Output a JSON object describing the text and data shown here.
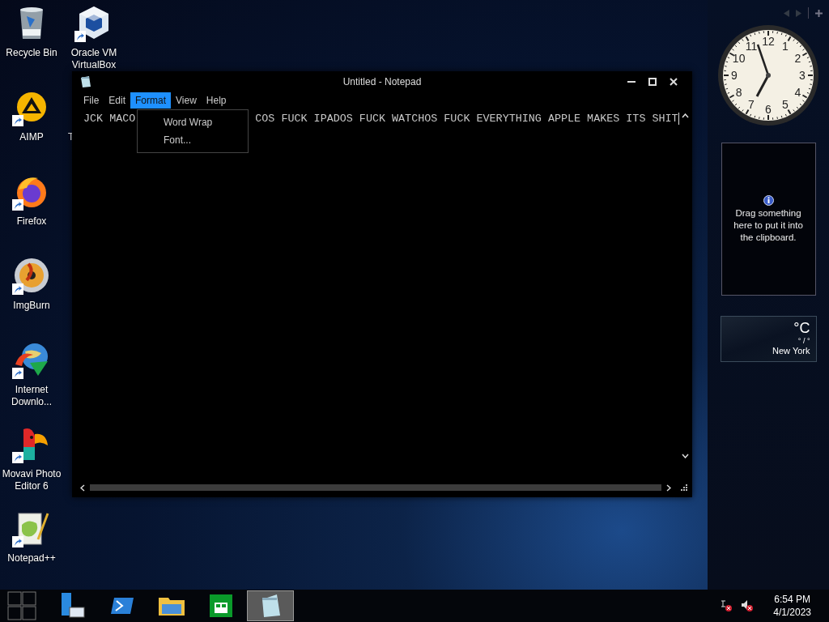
{
  "desktop_icons": [
    {
      "label": "Recycle Bin",
      "kind": "recycle",
      "shortcut": false
    },
    {
      "label": "AIMP",
      "kind": "aimp",
      "shortcut": true
    },
    {
      "label": "Firefox",
      "kind": "firefox",
      "shortcut": true
    },
    {
      "label": "ImgBurn",
      "kind": "disc",
      "shortcut": true
    },
    {
      "label": "Internet Downlo...",
      "kind": "globe",
      "shortcut": true
    },
    {
      "label": "Movavi Photo Editor 6",
      "kind": "parrot",
      "shortcut": true
    },
    {
      "label": "Notepad++",
      "kind": "notepadpp",
      "shortcut": true
    },
    {
      "label": "Oracle VM VirtualBox",
      "kind": "cube",
      "shortcut": true
    }
  ],
  "hidden_icon_label": "T",
  "notepad": {
    "title": "Untitled - Notepad",
    "menu": [
      {
        "label": "File",
        "selected": false
      },
      {
        "label": "Edit",
        "selected": false
      },
      {
        "label": "Format",
        "selected": true
      },
      {
        "label": "View",
        "selected": false
      },
      {
        "label": "Help",
        "selected": false
      }
    ],
    "dropdown": [
      {
        "label": "Word Wrap"
      },
      {
        "label": "Font..."
      }
    ],
    "text_segments": [
      "JCK MACO",
      "COS FUCK IPADOS FUCK WATCHOS FUCK EVERYTHING APPLE MAKES ITS SHIT"
    ]
  },
  "gadgets": {
    "clock": {
      "numerals": [
        "11",
        "12",
        "1",
        "10",
        "2",
        "9",
        "3",
        "8",
        "4",
        "7",
        "5",
        "6"
      ]
    },
    "clipboard": {
      "message": "Drag something here to put it into the clipboard."
    },
    "weather": {
      "temperature": "°C",
      "range": "° / °",
      "city": "New York"
    }
  },
  "taskbar": {
    "apps": [
      {
        "kind": "server",
        "selected": false
      },
      {
        "kind": "powershell",
        "selected": false
      },
      {
        "kind": "explorer",
        "selected": false
      },
      {
        "kind": "store",
        "selected": false
      },
      {
        "kind": "notepad",
        "selected": true
      }
    ],
    "time": "6:54 PM",
    "date": "4/1/2023"
  }
}
